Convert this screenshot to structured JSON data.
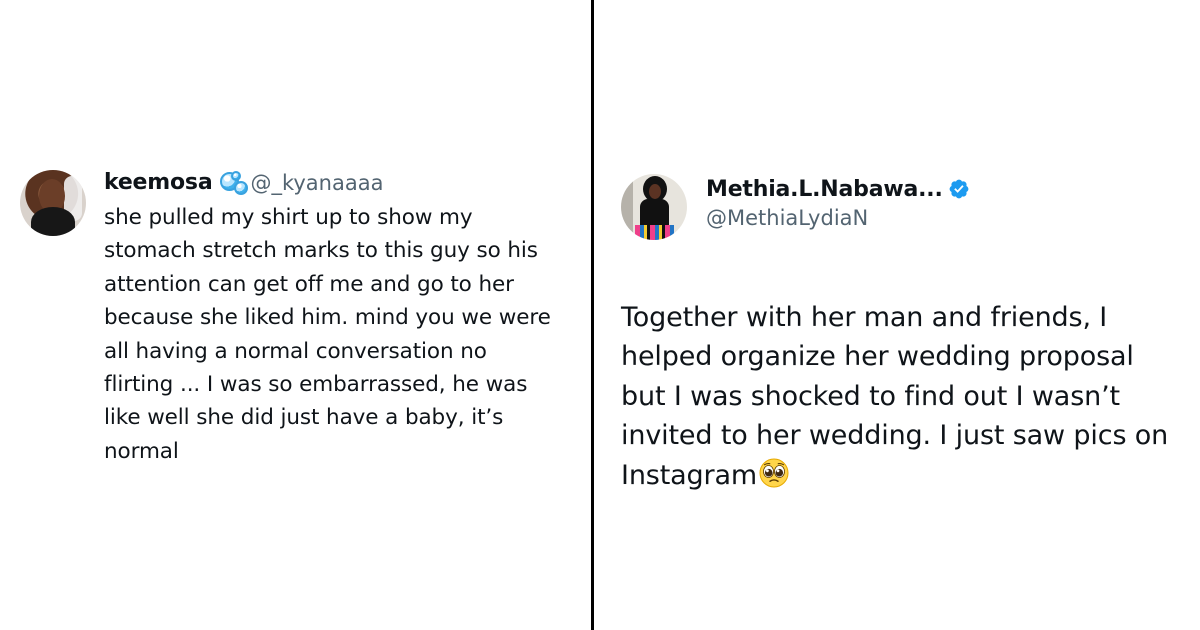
{
  "layout": {
    "background": "#ffffff",
    "divider_color": "#000000",
    "text_color": "#0f1419",
    "secondary_text_color": "#536471",
    "verified_color": "#1d9bf0"
  },
  "tweets": [
    {
      "avatar_icon": "profile-photo",
      "name": "keemosa",
      "name_icon": "bubbles-emoji-icon",
      "handle": "@_kyanaaaa",
      "text": "she pulled my shirt up to show my\nstomach stretch marks to this guy so his\nattention can get off me and go to her\nbecause she liked him. mind you we were\nall having a normal conversation no\nflirting ... I was so embarrassed, he was\nlike well she did just have a baby, it’s\nnormal"
    },
    {
      "avatar_icon": "profile-photo",
      "name": "Methia.L.Nabawa...",
      "verified_icon": "verified-badge-icon",
      "handle": "@MethiaLydiaN",
      "text": "Together with her man and friends, I\nhelped organize her wedding proposal\nbut I was shocked to find out I wasn’t\ninvited to her wedding. I just saw pics on\nInstagram",
      "text_icon": "pleading-face-emoji-icon"
    }
  ]
}
